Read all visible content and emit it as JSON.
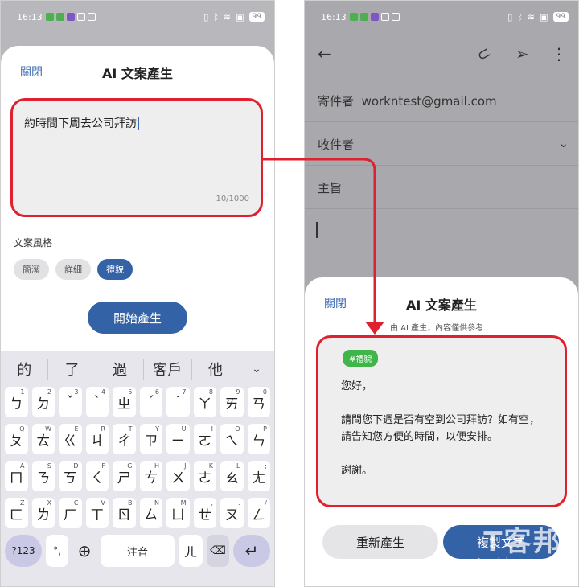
{
  "status": {
    "time": "16:13",
    "battery": "99"
  },
  "left": {
    "close": "關閉",
    "title": "AI 文案產生",
    "prompt": "約時間下周去公司拜訪",
    "counter": "10/1000",
    "style_label": "文案風格",
    "chips": [
      "簡潔",
      "詳細",
      "禮貌"
    ],
    "generate": "開始產生",
    "keyboard": {
      "suggestions": [
        "的",
        "了",
        "過",
        "客戶",
        "他"
      ],
      "rows": [
        {
          "keys": [
            "ㄅ",
            "ㄉ",
            "ˇ",
            "ˋ",
            "ㄓ",
            "ˊ",
            "˙",
            "ㄚ",
            "ㄞ",
            "ㄢ"
          ],
          "hints": [
            "1",
            "2",
            "3",
            "4",
            "5",
            "6",
            "7",
            "8",
            "9",
            "0"
          ]
        },
        {
          "keys": [
            "ㄆ",
            "ㄊ",
            "ㄍ",
            "ㄐ",
            "ㄔ",
            "ㄗ",
            "ㄧ",
            "ㄛ",
            "ㄟ",
            "ㄣ"
          ],
          "hints": [
            "Q",
            "W",
            "E",
            "R",
            "T",
            "Y",
            "U",
            "I",
            "O",
            "P"
          ]
        },
        {
          "keys": [
            "ㄇ",
            "ㄋ",
            "ㄎ",
            "ㄑ",
            "ㄕ",
            "ㄘ",
            "ㄨ",
            "ㄜ",
            "ㄠ",
            "ㄤ"
          ],
          "hints": [
            "A",
            "S",
            "D",
            "F",
            "G",
            "H",
            "J",
            "K",
            "L",
            ";"
          ]
        },
        {
          "keys": [
            "ㄈ",
            "ㄌ",
            "ㄏ",
            "ㄒ",
            "ㄖ",
            "ㄙ",
            "ㄩ",
            "ㄝ",
            "ㄡ",
            "ㄥ"
          ],
          "hints": [
            "Z",
            "X",
            "C",
            "V",
            "B",
            "N",
            "M",
            ",",
            ".",
            "/"
          ]
        }
      ],
      "sym": "?123",
      "punct": "°,",
      "space": "注音",
      "er": "ㄦ",
      "enter": "↵"
    }
  },
  "right": {
    "from_label": "寄件者",
    "from_value": "workntest@gmail.com",
    "to_label": "收件者",
    "subject_label": "主旨",
    "close": "關閉",
    "title": "AI 文案產生",
    "subtitle": "由 AI 產生，內容僅供參考",
    "tag": "#禮貌",
    "paragraphs": [
      "您好，",
      "請問您下週是否有空到公司拜訪？如有空，請告知您方便的時間，以便安排。",
      "謝謝。"
    ],
    "regenerate": "重新產生",
    "copy": "複製文字"
  },
  "watermark": {
    "zh": "T客邦",
    "en": "techbang.com"
  },
  "colors": {
    "accent": "#3362a6",
    "highlight": "#e0202e",
    "tag": "#3fb54a"
  }
}
